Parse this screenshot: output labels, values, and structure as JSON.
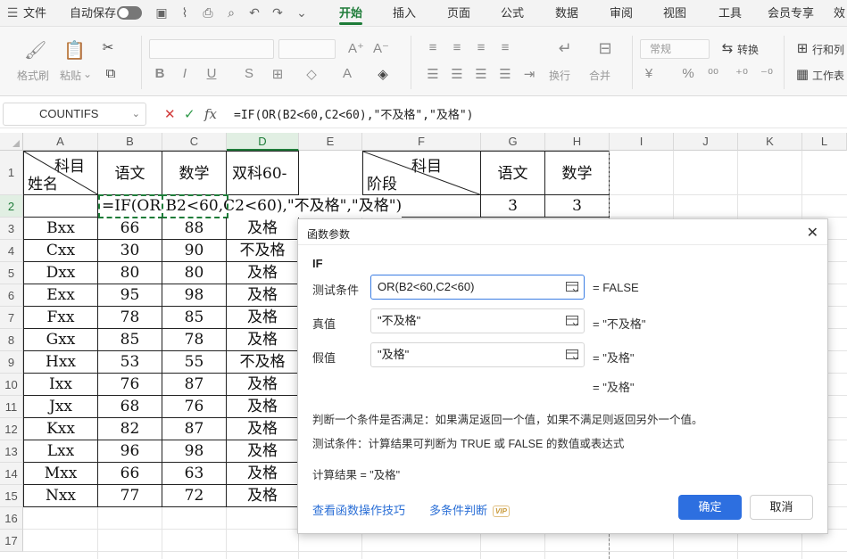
{
  "tabbar": {
    "file": "文件",
    "autosave": "自动保存",
    "tabs": [
      "开始",
      "插入",
      "页面",
      "公式",
      "数据",
      "审阅",
      "视图",
      "工具",
      "会员专享",
      "效"
    ]
  },
  "ribbon": {
    "format_painter": "格式刷",
    "paste": "粘贴",
    "number_format": "常规",
    "convert": "转换",
    "wrap": "换行",
    "merge": "合并",
    "row_col": "行和列",
    "worksheet": "工作表",
    "currency_symbol": "¥"
  },
  "formula_bar": {
    "name_box": "COUNTIFS",
    "fx": "fx",
    "formula": "=IF(OR(B2<60,C2<60),\"不及格\",\"及格\")"
  },
  "columns": [
    "A",
    "B",
    "C",
    "D",
    "E",
    "F",
    "G",
    "H",
    "I",
    "J",
    "K",
    "L"
  ],
  "rows": [
    "1",
    "2",
    "3",
    "4",
    "5",
    "6",
    "7",
    "8",
    "9",
    "10",
    "11",
    "12",
    "13",
    "14",
    "15",
    "16",
    "17"
  ],
  "sheet": {
    "header_top": "科目",
    "header_bottom": "姓名",
    "col_chinese": "语文",
    "col_math": "数学",
    "col_result": "双科60-",
    "f_header_top": "科目",
    "f_header_bottom": "阶段",
    "g_header": "语文",
    "h_header": "数学",
    "g2": "3",
    "h2": "3",
    "d2_edit": "=IF(OR B2<60,C2<60),\"不及格\",\"及格\")",
    "data": [
      [
        "Bxx",
        "66",
        "88",
        "及格"
      ],
      [
        "Cxx",
        "30",
        "90",
        "不及格"
      ],
      [
        "Dxx",
        "80",
        "80",
        "及格"
      ],
      [
        "Exx",
        "95",
        "98",
        "及格"
      ],
      [
        "Fxx",
        "78",
        "85",
        "及格"
      ],
      [
        "Gxx",
        "85",
        "78",
        "及格"
      ],
      [
        "Hxx",
        "53",
        "55",
        "不及格"
      ],
      [
        "Ixx",
        "76",
        "87",
        "及格"
      ],
      [
        "Jxx",
        "68",
        "76",
        "及格"
      ],
      [
        "Kxx",
        "82",
        "87",
        "及格"
      ],
      [
        "Lxx",
        "96",
        "98",
        "及格"
      ],
      [
        "Mxx",
        "66",
        "63",
        "及格"
      ],
      [
        "Nxx",
        "77",
        "72",
        "及格"
      ]
    ]
  },
  "dialog": {
    "title": "函数参数",
    "function": "IF",
    "args": [
      {
        "label": "测试条件",
        "value": "OR(B2<60,C2<60)",
        "result": "=  FALSE"
      },
      {
        "label": "真值",
        "value": "\"不及格\"",
        "result": "=  \"不及格\""
      },
      {
        "label": "假值",
        "value": "\"及格\"",
        "result": "=  \"及格\""
      }
    ],
    "overall_result": "=  \"及格\"",
    "description": "判断一个条件是否满足：如果满足返回一个值，如果不满足则返回另外一个值。",
    "arg_description": "测试条件：计算结果可判断为 TRUE 或 FALSE 的数值或表达式",
    "calc_result": "计算结果  =  \"及格\"",
    "link_tips": "查看函数操作技巧",
    "link_multi": "多条件判断",
    "vip": "VIP",
    "ok": "确定",
    "cancel": "取消"
  }
}
